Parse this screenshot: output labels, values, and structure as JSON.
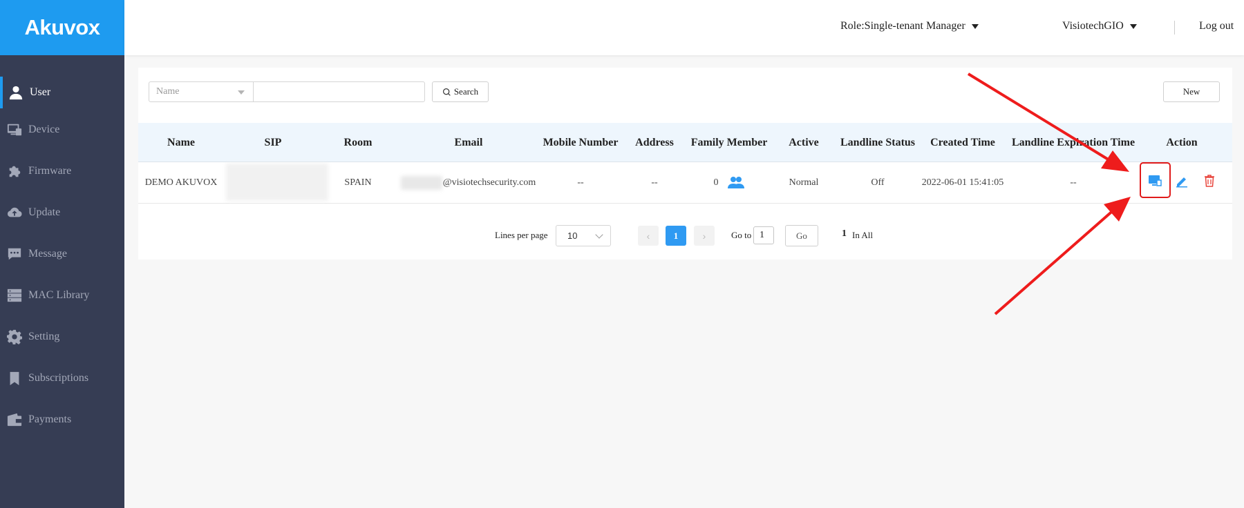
{
  "brand": {
    "logo_text": "Akuvox",
    "accent": "#1e9bf0",
    "sidebar_bg": "#363d54"
  },
  "header": {
    "role": "Role:Single-tenant Manager",
    "account": "VisiotechGIO",
    "logout": "Log out"
  },
  "sidebar": {
    "items": [
      {
        "label": "User",
        "icon": "user-icon",
        "active": true
      },
      {
        "label": "Device",
        "icon": "device-icon"
      },
      {
        "label": "Firmware",
        "icon": "puzzle-icon"
      },
      {
        "label": "Update",
        "icon": "cloud-upload-icon"
      },
      {
        "label": "Message",
        "icon": "message-icon"
      },
      {
        "label": "MAC Library",
        "icon": "server-icon"
      },
      {
        "label": "Setting",
        "icon": "gear-icon"
      },
      {
        "label": "Subscriptions",
        "icon": "bookmark-icon"
      },
      {
        "label": "Payments",
        "icon": "wallet-icon"
      }
    ]
  },
  "search": {
    "field_placeholder": "Name",
    "value": "",
    "search_label": "Search",
    "new_label": "New"
  },
  "table": {
    "columns": [
      "Name",
      "SIP",
      "Room",
      "Email",
      "Mobile Number",
      "Address",
      "Family Member",
      "Active",
      "Landline Status",
      "Created Time",
      "Landline Expiration Time",
      "Action"
    ],
    "rows": [
      {
        "name": "DEMO AKUVOX",
        "room": "SPAIN",
        "email": "@visiotechsecurity.com",
        "mobile": "--",
        "address": "--",
        "family_member": "0",
        "active": "Normal",
        "landline_status": "Off",
        "created_time": "2022-06-01 15:41:05",
        "landline_expiration": "--"
      }
    ]
  },
  "pagination": {
    "lines_per_page_label": "Lines per page",
    "lines_per_page": "10",
    "current_page": "1",
    "goto_label": "Go to",
    "goto_value": "1",
    "go_label": "Go",
    "total": "1",
    "total_label": "In All"
  }
}
